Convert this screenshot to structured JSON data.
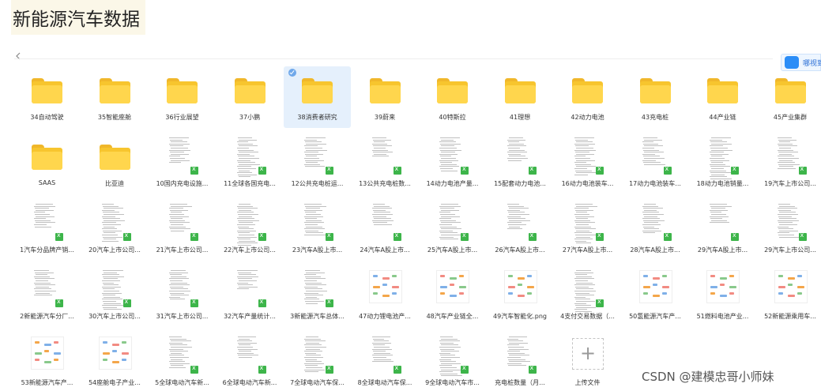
{
  "page": {
    "title": "新能源汽车数据"
  },
  "cloud_button": {
    "label": "哪视到"
  },
  "upload_tile": {
    "label": "上传文件",
    "icon": "plus-icon"
  },
  "watermark": "CSDN @建模忠哥小师妹",
  "colors": {
    "folder": "#ffd64d",
    "excel_badge": "#3db54a",
    "selection": "#e5f0fc",
    "accent": "#2b8df7"
  },
  "rows": [
    [
      {
        "label": "34自动驾驶",
        "type": "folder"
      },
      {
        "label": "35智能座舱",
        "type": "folder"
      },
      {
        "label": "36行业展望",
        "type": "folder"
      },
      {
        "label": "37小鹏",
        "type": "folder"
      },
      {
        "label": "38消费者研究",
        "type": "folder",
        "selected": true
      },
      {
        "label": "39蔚来",
        "type": "folder"
      },
      {
        "label": "40特斯拉",
        "type": "folder"
      },
      {
        "label": "41理想",
        "type": "folder"
      },
      {
        "label": "42动力电池",
        "type": "folder"
      },
      {
        "label": "43充电桩",
        "type": "folder"
      },
      {
        "label": "44产业链",
        "type": "folder"
      },
      {
        "label": "45产业集群",
        "type": "folder"
      }
    ],
    [
      {
        "label": "SAAS",
        "type": "folder"
      },
      {
        "label": "比亚迪",
        "type": "folder"
      },
      {
        "label": "10国内充电设施...",
        "type": "excel"
      },
      {
        "label": "11全球各国充电...",
        "type": "excel"
      },
      {
        "label": "12公共充电桩运...",
        "type": "excel"
      },
      {
        "label": "13公共充电桩数...",
        "type": "excel"
      },
      {
        "label": "14动力电池产量...",
        "type": "excel"
      },
      {
        "label": "15配套动力电池...",
        "type": "excel"
      },
      {
        "label": "16动力电池装车...",
        "type": "excel"
      },
      {
        "label": "17动力电池装车...",
        "type": "excel"
      },
      {
        "label": "18动力电池销量...",
        "type": "excel"
      },
      {
        "label": "19汽车上市公司...",
        "type": "excel"
      }
    ],
    [
      {
        "label": "1汽车分品牌产销...",
        "type": "excel"
      },
      {
        "label": "20汽车上市公司...",
        "type": "excel"
      },
      {
        "label": "21汽车上市公司...",
        "type": "excel"
      },
      {
        "label": "22汽车上市公司...",
        "type": "excel"
      },
      {
        "label": "23汽车A股上市...",
        "type": "excel"
      },
      {
        "label": "24汽车A股上市...",
        "type": "excel"
      },
      {
        "label": "25汽车A股上市...",
        "type": "excel"
      },
      {
        "label": "26汽车A股上市...",
        "type": "excel"
      },
      {
        "label": "27汽车A股上市...",
        "type": "excel"
      },
      {
        "label": "28汽车A股上市...",
        "type": "excel"
      },
      {
        "label": "29汽车A股上市...",
        "type": "excel"
      },
      {
        "label": "29汽车上市公司...",
        "type": "excel"
      }
    ],
    [
      {
        "label": "2新能源汽车分厂...",
        "type": "excel"
      },
      {
        "label": "30汽车上市公司...",
        "type": "excel"
      },
      {
        "label": "31汽车上市公司...",
        "type": "excel"
      },
      {
        "label": "32汽车产量统计...",
        "type": "excel"
      },
      {
        "label": "3新能源汽车总体...",
        "type": "excel"
      },
      {
        "label": "47动力锂电池产...",
        "type": "mindmap"
      },
      {
        "label": "48汽车产业链全...",
        "type": "mindmap"
      },
      {
        "label": "49汽车智能化.png",
        "type": "mindmap"
      },
      {
        "label": "4支付交易数据（...",
        "type": "excel"
      },
      {
        "label": "50氢能源汽车产...",
        "type": "mindmap"
      },
      {
        "label": "51燃料电池产业...",
        "type": "mindmap"
      },
      {
        "label": "52新能源乘用车...",
        "type": "mindmap"
      }
    ],
    [
      {
        "label": "53新能源汽车产...",
        "type": "mindmap"
      },
      {
        "label": "54座舱电子产业...",
        "type": "mindmap"
      },
      {
        "label": "5全球电动汽车新...",
        "type": "excel"
      },
      {
        "label": "6全球电动汽车新...",
        "type": "excel"
      },
      {
        "label": "7全球电动汽车保...",
        "type": "excel"
      },
      {
        "label": "8全球电动汽车保...",
        "type": "excel"
      },
      {
        "label": "9全球电动汽车市...",
        "type": "excel"
      },
      {
        "label": "充电桩数量（月...",
        "type": "excel"
      },
      {
        "label": "上传文件",
        "type": "upload"
      }
    ]
  ]
}
